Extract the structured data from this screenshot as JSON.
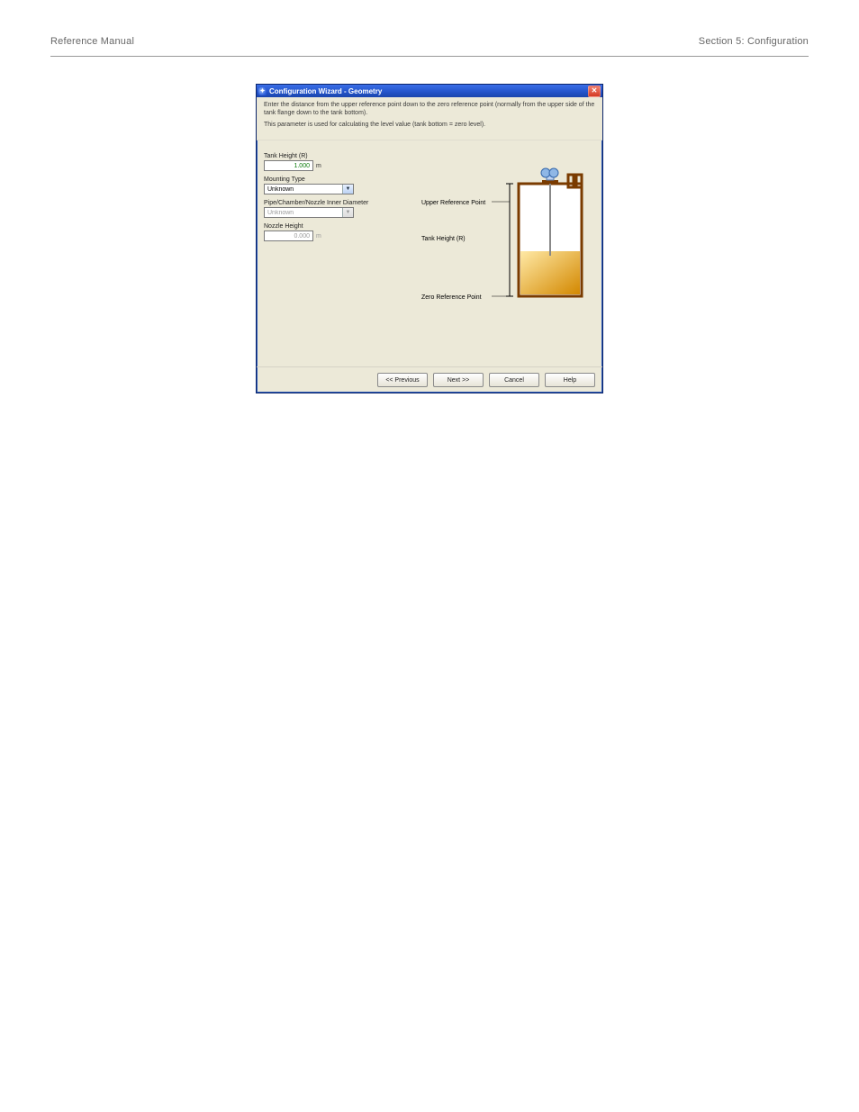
{
  "page_header": {
    "left": "Reference Manual",
    "right": "Section 5: Configuration"
  },
  "dialog": {
    "title": "Configuration Wizard - Geometry",
    "instruction_line1": "Enter the distance from the upper reference point down to the zero reference point (normally from the upper side of the tank flange down to the tank bottom).",
    "instruction_line2": "This parameter is used for calculating the level value (tank bottom = zero level).",
    "fields": {
      "tank_height_label": "Tank Height (R)",
      "tank_height_value": "1.000",
      "tank_height_unit": "m",
      "mounting_type_label": "Mounting Type",
      "mounting_type_value": "Unknown",
      "inner_diameter_label": "Pipe/Chamber/Nozzle Inner Diameter",
      "inner_diameter_value": "Unknown",
      "nozzle_height_label": "Nozzle Height",
      "nozzle_height_value": "0.000",
      "nozzle_height_unit": "m"
    },
    "diagram": {
      "upper_ref_label": "Upper Reference Point",
      "tank_height_label": "Tank Height (R)",
      "zero_ref_label": "Zero Reference Point"
    },
    "buttons": {
      "previous": "<< Previous",
      "next": "Next >>",
      "cancel": "Cancel",
      "help": "Help"
    }
  }
}
